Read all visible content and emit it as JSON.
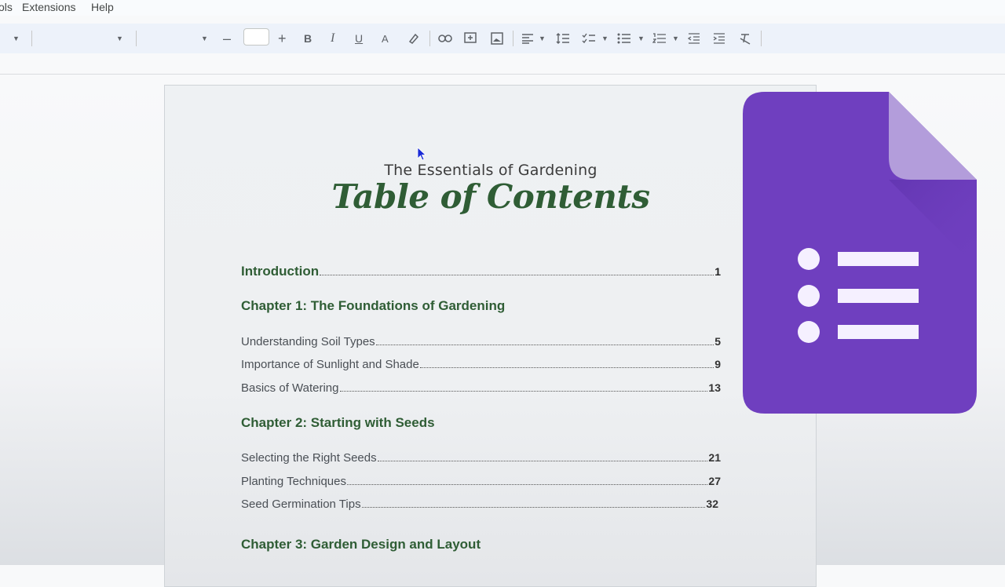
{
  "menubar": {
    "items": [
      {
        "label": "ols"
      },
      {
        "label": "Extensions"
      },
      {
        "label": "Help"
      }
    ]
  },
  "toolbar": {
    "minus_label": "–",
    "plus_label": "+",
    "bold_label": "B",
    "italic_label": "I",
    "underline_label": "U",
    "text_color_label": "A"
  },
  "document": {
    "subtitle": "The Essentials of Gardening",
    "title": "Table of Contents",
    "intro": {
      "label": "Introduction",
      "page": "1"
    },
    "chapters": [
      {
        "title": "Chapter 1: The Foundations of Gardening",
        "entries": [
          {
            "label": "Understanding Soil Types",
            "page": "5"
          },
          {
            "label": "Importance of Sunlight and Shade",
            "page": "9"
          },
          {
            "label": "Basics of Watering",
            "page": "13"
          }
        ]
      },
      {
        "title": "Chapter 2: Starting with Seeds",
        "entries": [
          {
            "label": "Selecting the Right Seeds",
            "page": "21"
          },
          {
            "label": "Planting Techniques",
            "page": "27"
          },
          {
            "label": "Seed Germination Tips",
            "page": "32"
          }
        ]
      },
      {
        "title": "Chapter 3: Garden Design and Layout",
        "entries": []
      }
    ]
  },
  "colors": {
    "heading_green": "#2f5d35",
    "forms_purple": "#6f3fbf",
    "forms_fold": "#b39ddb"
  },
  "icons": {
    "forms_logo": "google-forms-icon",
    "cursor": "mouse-pointer-icon"
  }
}
